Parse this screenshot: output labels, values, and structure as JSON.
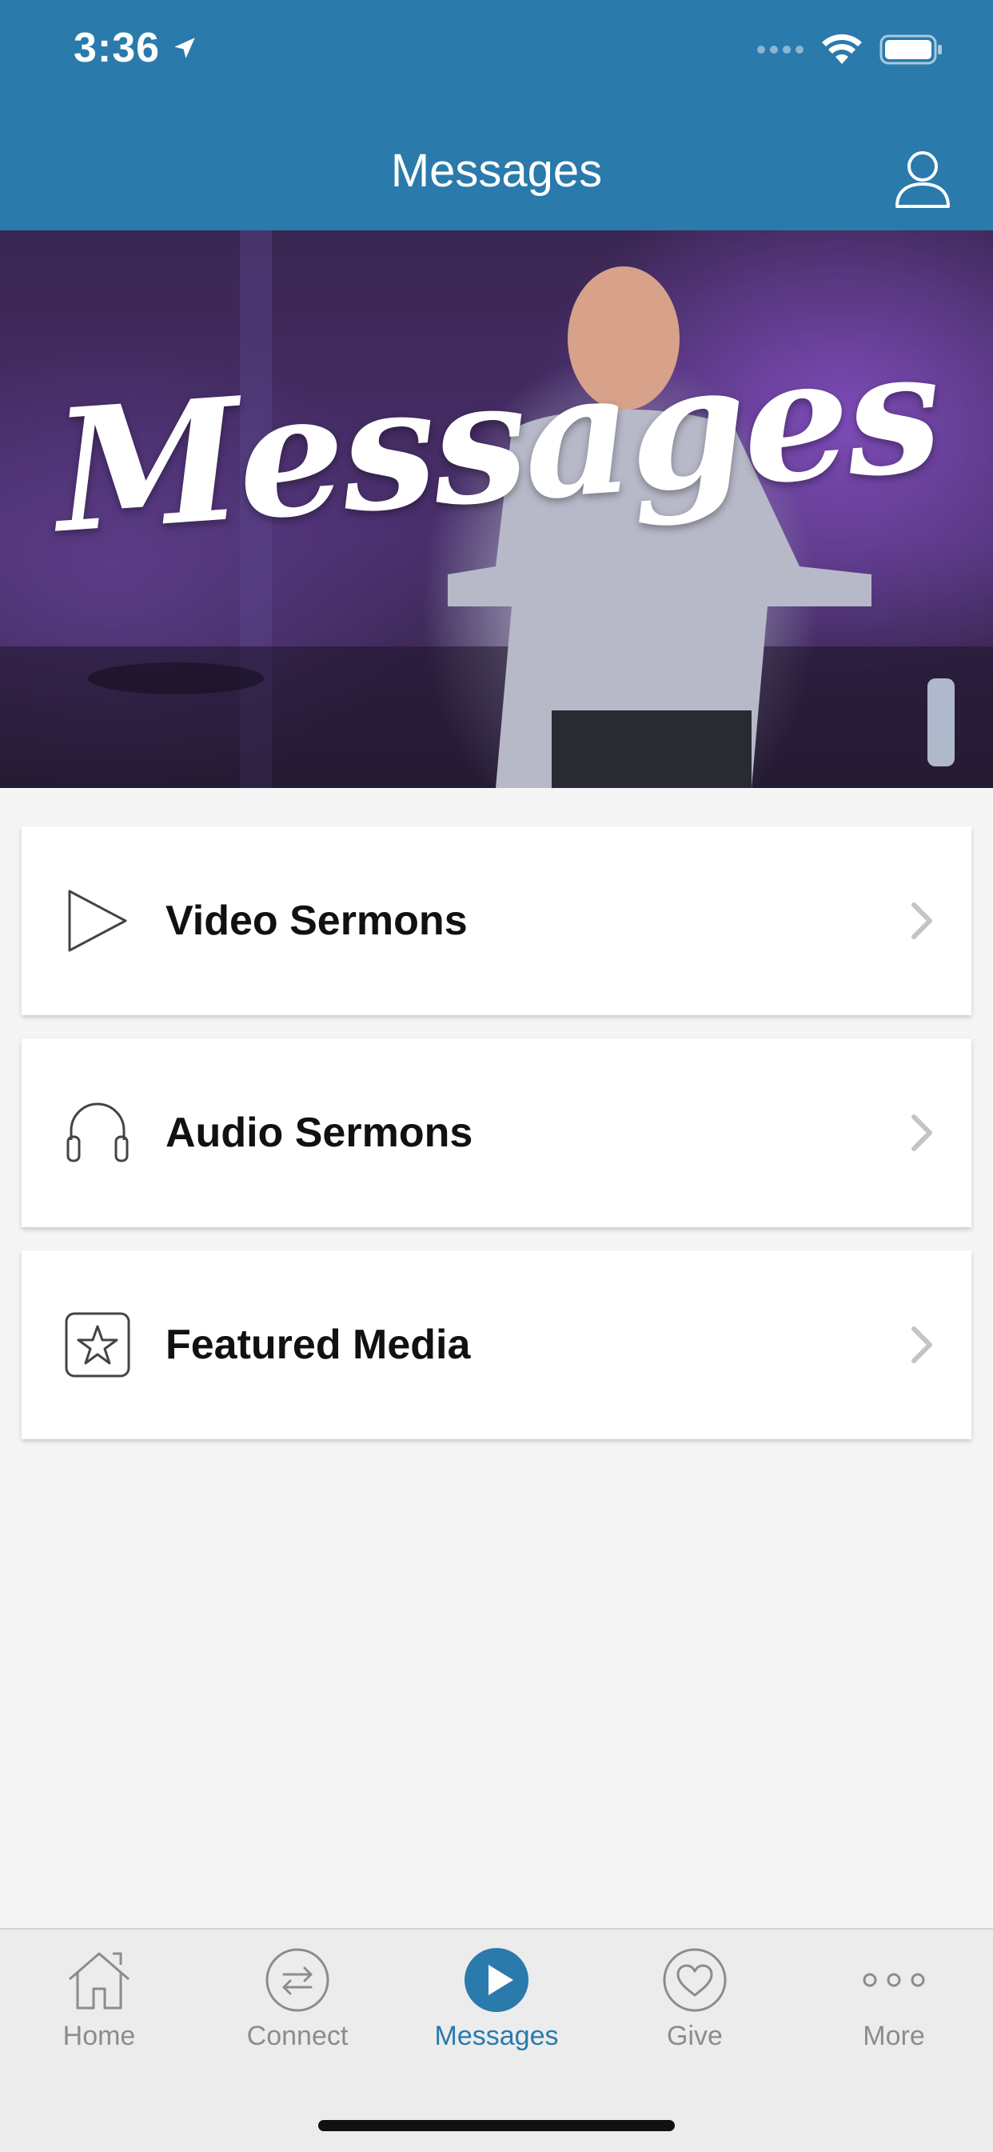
{
  "status": {
    "time": "3:36"
  },
  "header": {
    "title": "Messages"
  },
  "hero": {
    "title": "Messages"
  },
  "menu": [
    {
      "label": "Video Sermons",
      "icon": "play-icon"
    },
    {
      "label": "Audio Sermons",
      "icon": "headphones-icon"
    },
    {
      "label": "Featured Media",
      "icon": "star-icon"
    }
  ],
  "tabs": [
    {
      "label": "Home",
      "icon": "home-icon"
    },
    {
      "label": "Connect",
      "icon": "connect-arrows-icon"
    },
    {
      "label": "Messages",
      "icon": "play-circle-icon",
      "active": true
    },
    {
      "label": "Give",
      "icon": "heart-icon"
    },
    {
      "label": "More",
      "icon": "more-dots-icon"
    }
  ],
  "colors": {
    "accent": "#2a7aac",
    "tab_inactive": "#8c8c8c",
    "background": "#f5f5f5"
  }
}
